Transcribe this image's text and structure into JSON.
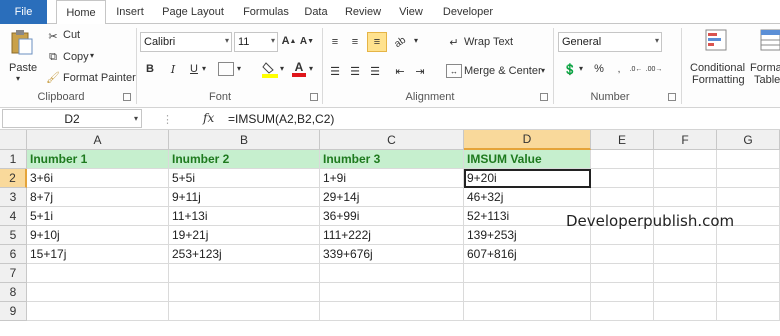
{
  "tabs": [
    "File",
    "Home",
    "Insert",
    "Page Layout",
    "Formulas",
    "Data",
    "Review",
    "View",
    "Developer"
  ],
  "clipboard": {
    "paste": "Paste",
    "cut": "Cut",
    "copy": "Copy",
    "format_painter": "Format Painter",
    "label": "Clipboard"
  },
  "font": {
    "name": "Calibri",
    "size": "11",
    "label": "Font"
  },
  "alignment": {
    "wrap_text": "Wrap Text",
    "merge_center": "Merge & Center",
    "label": "Alignment"
  },
  "number": {
    "format": "General",
    "label": "Number",
    "percent": "%"
  },
  "styles": {
    "conditional_1": "Conditional",
    "conditional_2": "Formatting",
    "format_1": "Format",
    "format_2": "Table"
  },
  "formula_bar": {
    "name_box": "D2",
    "fx": "fx",
    "formula": "=IMSUM(A2,B2,C2)"
  },
  "columns": [
    "A",
    "B",
    "C",
    "D",
    "E",
    "F",
    "G"
  ],
  "rows": [
    "1",
    "2",
    "3",
    "4",
    "5",
    "6",
    "7",
    "8",
    "9"
  ],
  "cells": [
    [
      "Inumber 1",
      "Inumber 2",
      "Inumber 3",
      "IMSUM Value"
    ],
    [
      "3+6i",
      "5+5i",
      "1+9i",
      "9+20i"
    ],
    [
      "8+7j",
      "9+11j",
      "29+14j",
      "46+32j"
    ],
    [
      "5+1i",
      "11+13i",
      "36+99i",
      "52+113i"
    ],
    [
      "9+10j",
      "19+21j",
      "111+222j",
      "139+253j"
    ],
    [
      "15+17j",
      "253+123j",
      "339+676j",
      "607+816j"
    ]
  ],
  "watermark": "Developerpublish.com",
  "colors": {
    "file_tab": "#2a6ebb",
    "header_fill": "#c6efce",
    "header_text": "#1e7a1e",
    "selected_header": "#f9d99b"
  }
}
